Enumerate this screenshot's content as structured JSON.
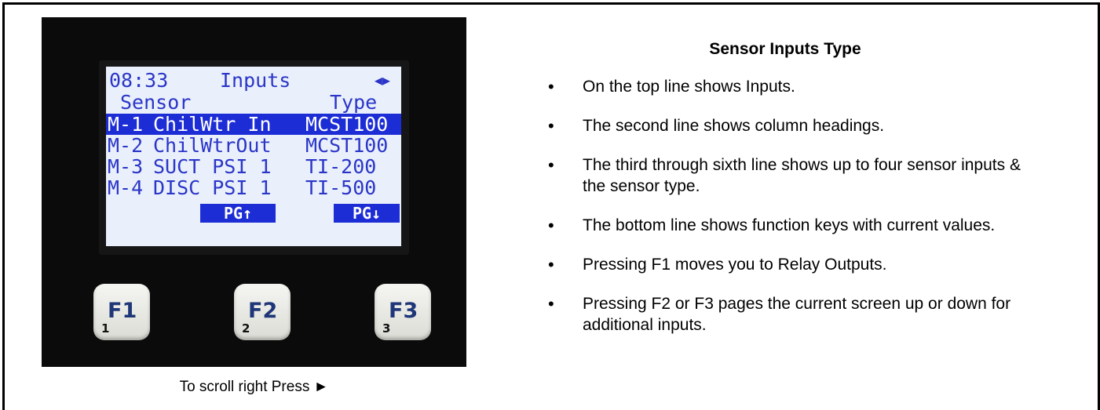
{
  "caption": "To scroll right Press ►",
  "title": "Sensor Inputs Type",
  "bullets": [
    "On the top line shows Inputs.",
    "The second line shows column headings.",
    "The third through sixth line shows up to four sensor inputs & the sensor type.",
    "The bottom line shows function keys with current values.",
    "Pressing F1 moves you to Relay Outputs.",
    "Pressing F2 or F3 pages the current screen up or down for additional inputs."
  ],
  "lcd": {
    "time": "08:33",
    "screen_name": "Inputs",
    "nav_arrows": "◂▸",
    "col_sensor": "Sensor",
    "col_type": "Type",
    "rows": [
      {
        "id": "M-1",
        "name": "ChilWtr In",
        "type": "MCST100",
        "selected": true
      },
      {
        "id": "M-2",
        "name": "ChilWtrOut",
        "type": "MCST100",
        "selected": false
      },
      {
        "id": "M-3",
        "name": "SUCT PSI 1",
        "type": "TI-200",
        "selected": false
      },
      {
        "id": "M-4",
        "name": "DISC PSI 1",
        "type": "TI-500",
        "selected": false
      }
    ],
    "pg_up": "PG↑",
    "pg_down": "PG↓"
  },
  "keys": [
    {
      "label": "F1",
      "num": "1"
    },
    {
      "label": "F2",
      "num": "2"
    },
    {
      "label": "F3",
      "num": "3"
    }
  ],
  "colors": {
    "lcd_text": "#2b35c8",
    "lcd_highlight": "#1d2dd6",
    "lcd_bg": "#e9f0fb"
  }
}
